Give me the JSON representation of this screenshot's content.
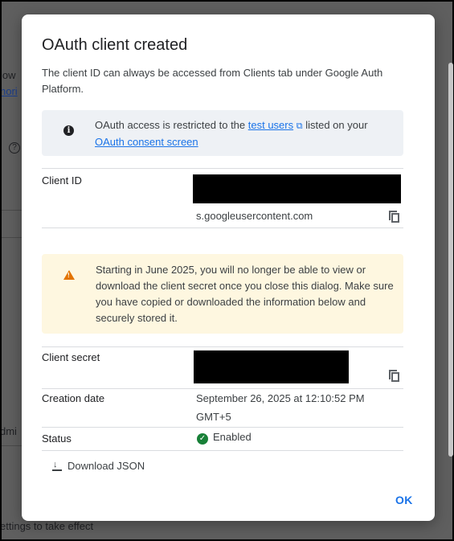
{
  "background": {
    "frag_low": "low",
    "frag_hori": "hori",
    "frag_help": "?",
    "frag_admin": "dmi",
    "frag_footer": "ettings to take effect"
  },
  "dialog": {
    "title": "OAuth client created",
    "description": "The client ID can always be accessed from Clients tab under Google Auth Platform.",
    "info": {
      "icon": "info-icon",
      "text_before": "OAuth access is restricted to the ",
      "link_test_users": "test users",
      "ext_icon": "⧉",
      "text_middle": " listed on your ",
      "link_consent": "OAuth consent screen"
    },
    "client_id": {
      "label": "Client ID",
      "suffix": "s.googleusercontent.com"
    },
    "warning": {
      "icon": "warning-icon",
      "text": "Starting in June 2025, you will no longer be able to view or download the client secret once you close this dialog. Make sure you have copied or downloaded the information below and securely stored it."
    },
    "client_secret": {
      "label": "Client secret"
    },
    "creation_date": {
      "label": "Creation date",
      "value_line1": "September 26, 2025 at 12:10:52 PM",
      "value_line2": "GMT+5"
    },
    "status": {
      "label": "Status",
      "value": "Enabled",
      "color": "#188038"
    },
    "download_label": "Download JSON",
    "ok_label": "OK",
    "accent_color": "#1a73e8"
  }
}
